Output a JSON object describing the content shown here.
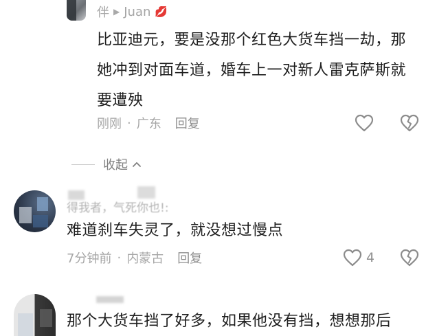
{
  "reply": {
    "author": "伴",
    "author_suffix": "Juan",
    "heart_emoji": "💋",
    "text": "比亚迪元，要是没那个红色大货车挡一劫，那她冲到对面车道，婚车上一对新人雷克萨斯就要遭殃",
    "time": "刚刚",
    "location": "广东",
    "reply_label": "回复"
  },
  "collapse": {
    "label": "收起",
    "chevron": "^"
  },
  "comments": [
    {
      "author": "得我者，气死你也!:",
      "text": "难道刹车失灵了，就没想过慢点",
      "time": "7分钟前",
      "location": "内蒙古",
      "reply_label": "回复",
      "like_count": "4"
    },
    {
      "text": "那个大货车挡了好多，如果他没有挡，想想那后"
    }
  ],
  "icons": {
    "like": "heart-outline-icon",
    "dislike": "broken-heart-outline-icon"
  },
  "colors": {
    "text": "#1e1e1e",
    "meta": "#a6a6a6",
    "icon": "#8c8c8c"
  }
}
